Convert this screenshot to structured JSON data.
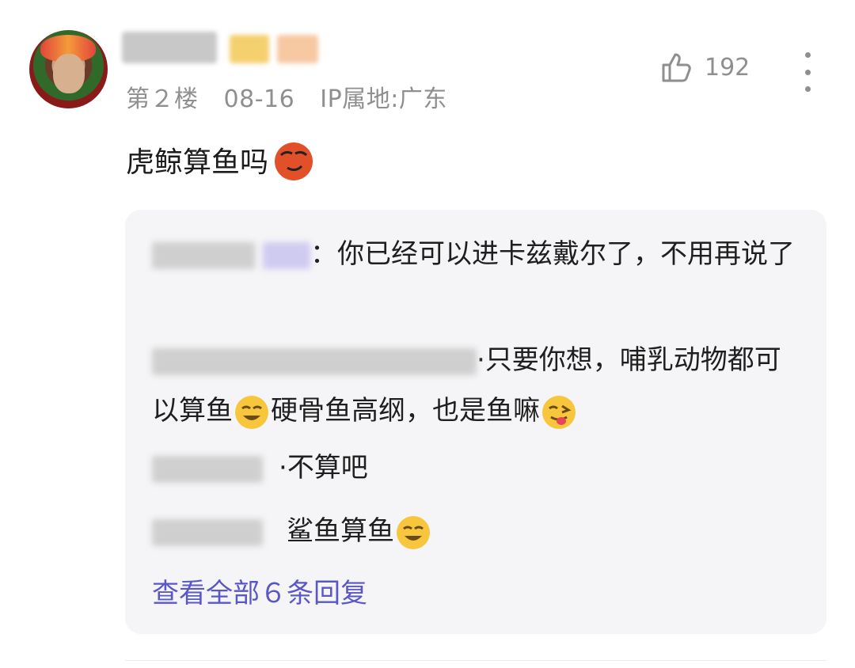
{
  "post": {
    "floor": "第２楼",
    "date": "08-16",
    "ip": "IP属地:广东",
    "like_count": "192",
    "text": "虎鲸算鱼吗",
    "text_emoji": "devil-face-icon"
  },
  "replies": [
    {
      "sep": "：",
      "text": "你已经可以进卡兹戴尔了，不用再说了"
    },
    {
      "sep": "·",
      "text": "只要你想，哺乳动物都可以算鱼",
      "text_cont": "硬骨鱼高纲，也是鱼嘛"
    },
    {
      "sep": "·",
      "text": "不算吧"
    },
    {
      "sep": "",
      "text": "鲨鱼算鱼"
    }
  ],
  "view_all": "查看全部６条回复",
  "colors": {
    "accent": "#5a57c7",
    "meta": "#8f8f8f",
    "reply_bg": "#f5f5f7"
  }
}
